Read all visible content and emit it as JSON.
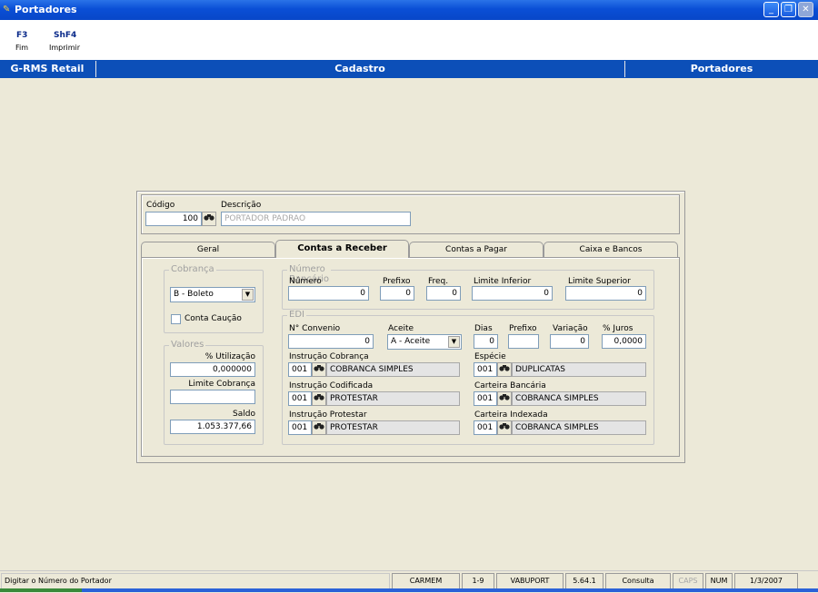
{
  "window": {
    "title": "Portadores"
  },
  "toolbar": {
    "items": [
      {
        "key": "F3",
        "label": "Fim"
      },
      {
        "key": "ShF4",
        "label": "Imprimir"
      }
    ]
  },
  "header": {
    "app": "G-RMS Retail",
    "section": "Cadastro",
    "screen": "Portadores"
  },
  "form": {
    "codigo_label": "Código",
    "codigo_value": "100",
    "descricao_label": "Descrição",
    "descricao_value": "PORTADOR PADRAO"
  },
  "tabs": [
    {
      "label": "Geral"
    },
    {
      "label": "Contas a Receber"
    },
    {
      "label": "Contas a Pagar"
    },
    {
      "label": "Caixa e Bancos"
    }
  ],
  "cobranca": {
    "title": "Cobrança",
    "selected": "B - Boleto",
    "conta_caucao": "Conta Caução"
  },
  "valores": {
    "title": "Valores",
    "utilizacao_label": "% Utilização",
    "utilizacao_value": "0,000000",
    "limite_label": "Limite Cobrança",
    "limite_value": "",
    "saldo_label": "Saldo",
    "saldo_value": "1.053.377,66"
  },
  "numero_bancario": {
    "title": "Número Bancário",
    "numero_label": "Número",
    "numero_value": "0",
    "prefixo_label": "Prefixo",
    "prefixo_value": "0",
    "freq_label": "Freq.",
    "freq_value": "0",
    "limite_inf_label": "Limite Inferior",
    "limite_inf_value": "0",
    "limite_sup_label": "Limite Superior",
    "limite_sup_value": "0"
  },
  "edi": {
    "title": "EDI",
    "convenio_label": "N° Convenio",
    "convenio_value": "0",
    "aceite_label": "Aceite",
    "aceite_value": "A - Aceite",
    "dias_label": "Dias",
    "dias_value": "0",
    "prefixo_label": "Prefixo",
    "prefixo_value": "",
    "variacao_label": "Variação",
    "variacao_value": "0",
    "juros_label": "% Juros",
    "juros_value": "0,0000",
    "instr_cobranca_label": "Instrução Cobrança",
    "instr_cobranca_code": "001",
    "instr_cobranca_desc": "COBRANCA SIMPLES",
    "especie_label": "Espécie",
    "especie_code": "001",
    "especie_desc": "DUPLICATAS",
    "instr_codificada_label": "Instrução Codificada",
    "instr_codificada_code": "001",
    "instr_codificada_desc": "PROTESTAR",
    "carteira_bancaria_label": "Carteira Bancária",
    "carteira_bancaria_code": "001",
    "carteira_bancaria_desc": "COBRANCA SIMPLES",
    "instr_protestar_label": "Instrução Protestar",
    "instr_protestar_code": "001",
    "instr_protestar_desc": "PROTESTAR",
    "carteira_indexada_label": "Carteira Indexada",
    "carteira_indexada_code": "001",
    "carteira_indexada_desc": "COBRANCA SIMPLES"
  },
  "status": {
    "message": "Digitar o Número do Portador",
    "user": "CARMEM",
    "range": "1-9",
    "db": "VABUPORT",
    "version": "5.64.1",
    "mode": "Consulta",
    "caps": "CAPS",
    "num": "NUM",
    "date": "1/3/2007"
  },
  "colors": {
    "titlebar": "#0A4FD6",
    "header": "#0C4FB8",
    "background": "#ECE9D8"
  },
  "icons": {
    "lookup": "binoculars-icon"
  }
}
